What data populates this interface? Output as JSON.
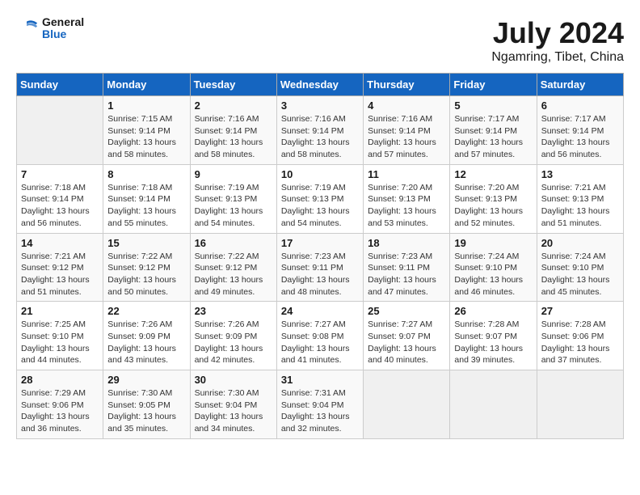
{
  "header": {
    "logo_general": "General",
    "logo_blue": "Blue",
    "title": "July 2024",
    "subtitle": "Ngamring, Tibet, China"
  },
  "days_of_week": [
    "Sunday",
    "Monday",
    "Tuesday",
    "Wednesday",
    "Thursday",
    "Friday",
    "Saturday"
  ],
  "weeks": [
    [
      {
        "day": "",
        "info": ""
      },
      {
        "day": "1",
        "info": "Sunrise: 7:15 AM\nSunset: 9:14 PM\nDaylight: 13 hours and 58 minutes."
      },
      {
        "day": "2",
        "info": "Sunrise: 7:16 AM\nSunset: 9:14 PM\nDaylight: 13 hours and 58 minutes."
      },
      {
        "day": "3",
        "info": "Sunrise: 7:16 AM\nSunset: 9:14 PM\nDaylight: 13 hours and 58 minutes."
      },
      {
        "day": "4",
        "info": "Sunrise: 7:16 AM\nSunset: 9:14 PM\nDaylight: 13 hours and 57 minutes."
      },
      {
        "day": "5",
        "info": "Sunrise: 7:17 AM\nSunset: 9:14 PM\nDaylight: 13 hours and 57 minutes."
      },
      {
        "day": "6",
        "info": "Sunrise: 7:17 AM\nSunset: 9:14 PM\nDaylight: 13 hours and 56 minutes."
      }
    ],
    [
      {
        "day": "7",
        "info": "Sunrise: 7:18 AM\nSunset: 9:14 PM\nDaylight: 13 hours and 56 minutes."
      },
      {
        "day": "8",
        "info": "Sunrise: 7:18 AM\nSunset: 9:14 PM\nDaylight: 13 hours and 55 minutes."
      },
      {
        "day": "9",
        "info": "Sunrise: 7:19 AM\nSunset: 9:13 PM\nDaylight: 13 hours and 54 minutes."
      },
      {
        "day": "10",
        "info": "Sunrise: 7:19 AM\nSunset: 9:13 PM\nDaylight: 13 hours and 54 minutes."
      },
      {
        "day": "11",
        "info": "Sunrise: 7:20 AM\nSunset: 9:13 PM\nDaylight: 13 hours and 53 minutes."
      },
      {
        "day": "12",
        "info": "Sunrise: 7:20 AM\nSunset: 9:13 PM\nDaylight: 13 hours and 52 minutes."
      },
      {
        "day": "13",
        "info": "Sunrise: 7:21 AM\nSunset: 9:13 PM\nDaylight: 13 hours and 51 minutes."
      }
    ],
    [
      {
        "day": "14",
        "info": "Sunrise: 7:21 AM\nSunset: 9:12 PM\nDaylight: 13 hours and 51 minutes."
      },
      {
        "day": "15",
        "info": "Sunrise: 7:22 AM\nSunset: 9:12 PM\nDaylight: 13 hours and 50 minutes."
      },
      {
        "day": "16",
        "info": "Sunrise: 7:22 AM\nSunset: 9:12 PM\nDaylight: 13 hours and 49 minutes."
      },
      {
        "day": "17",
        "info": "Sunrise: 7:23 AM\nSunset: 9:11 PM\nDaylight: 13 hours and 48 minutes."
      },
      {
        "day": "18",
        "info": "Sunrise: 7:23 AM\nSunset: 9:11 PM\nDaylight: 13 hours and 47 minutes."
      },
      {
        "day": "19",
        "info": "Sunrise: 7:24 AM\nSunset: 9:10 PM\nDaylight: 13 hours and 46 minutes."
      },
      {
        "day": "20",
        "info": "Sunrise: 7:24 AM\nSunset: 9:10 PM\nDaylight: 13 hours and 45 minutes."
      }
    ],
    [
      {
        "day": "21",
        "info": "Sunrise: 7:25 AM\nSunset: 9:10 PM\nDaylight: 13 hours and 44 minutes."
      },
      {
        "day": "22",
        "info": "Sunrise: 7:26 AM\nSunset: 9:09 PM\nDaylight: 13 hours and 43 minutes."
      },
      {
        "day": "23",
        "info": "Sunrise: 7:26 AM\nSunset: 9:09 PM\nDaylight: 13 hours and 42 minutes."
      },
      {
        "day": "24",
        "info": "Sunrise: 7:27 AM\nSunset: 9:08 PM\nDaylight: 13 hours and 41 minutes."
      },
      {
        "day": "25",
        "info": "Sunrise: 7:27 AM\nSunset: 9:07 PM\nDaylight: 13 hours and 40 minutes."
      },
      {
        "day": "26",
        "info": "Sunrise: 7:28 AM\nSunset: 9:07 PM\nDaylight: 13 hours and 39 minutes."
      },
      {
        "day": "27",
        "info": "Sunrise: 7:28 AM\nSunset: 9:06 PM\nDaylight: 13 hours and 37 minutes."
      }
    ],
    [
      {
        "day": "28",
        "info": "Sunrise: 7:29 AM\nSunset: 9:06 PM\nDaylight: 13 hours and 36 minutes."
      },
      {
        "day": "29",
        "info": "Sunrise: 7:30 AM\nSunset: 9:05 PM\nDaylight: 13 hours and 35 minutes."
      },
      {
        "day": "30",
        "info": "Sunrise: 7:30 AM\nSunset: 9:04 PM\nDaylight: 13 hours and 34 minutes."
      },
      {
        "day": "31",
        "info": "Sunrise: 7:31 AM\nSunset: 9:04 PM\nDaylight: 13 hours and 32 minutes."
      },
      {
        "day": "",
        "info": ""
      },
      {
        "day": "",
        "info": ""
      },
      {
        "day": "",
        "info": ""
      }
    ]
  ]
}
